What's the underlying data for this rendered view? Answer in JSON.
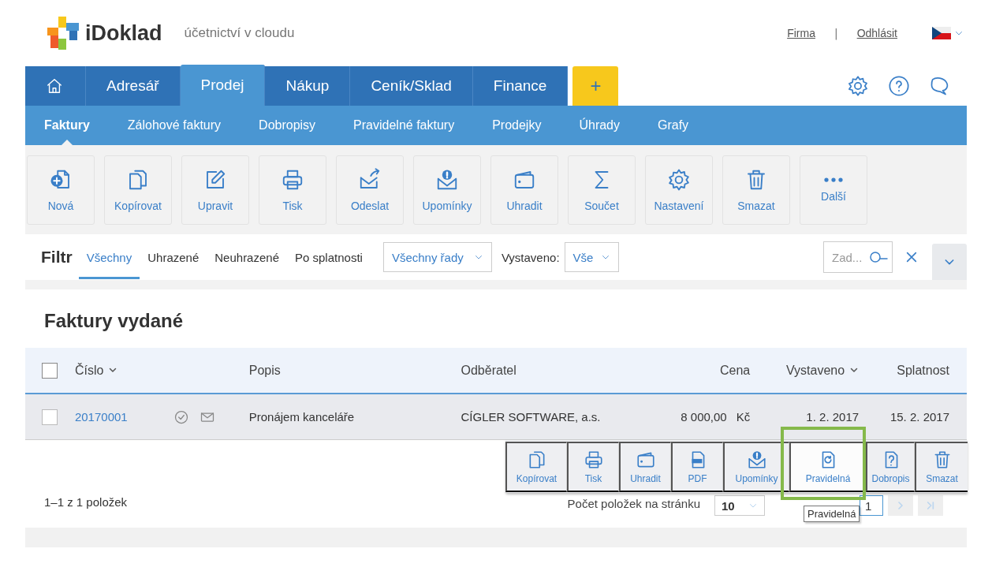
{
  "header": {
    "logo_text": "iDoklad",
    "tagline": "účetnictví v cloudu",
    "links": [
      "Firma",
      "Odhlásit"
    ],
    "separator": "|"
  },
  "main_tabs": [
    {
      "kind": "home",
      "selected": false
    },
    {
      "kind": "text",
      "label": "Adresář",
      "selected": false
    },
    {
      "kind": "text",
      "label": "Prodej",
      "selected": true
    },
    {
      "kind": "text",
      "label": "Nákup",
      "selected": false
    },
    {
      "kind": "text",
      "label": "Ceník/Sklad",
      "selected": false
    },
    {
      "kind": "text",
      "label": "Finance",
      "selected": false
    },
    {
      "kind": "add",
      "label": "+",
      "selected": false
    }
  ],
  "sub_tabs": [
    {
      "label": "Faktury",
      "selected": true
    },
    {
      "label": "Zálohové faktury",
      "selected": false
    },
    {
      "label": "Dobropisy",
      "selected": false
    },
    {
      "label": "Pravidelné faktury",
      "selected": false
    },
    {
      "label": "Prodejky",
      "selected": false
    },
    {
      "label": "Úhrady",
      "selected": false
    },
    {
      "label": "Grafy",
      "selected": false
    }
  ],
  "toolbar": [
    {
      "kind": "new",
      "label": "Nová"
    },
    {
      "kind": "copy",
      "label": "Kopírovat"
    },
    {
      "kind": "edit",
      "label": "Upravit"
    },
    {
      "kind": "print",
      "label": "Tisk"
    },
    {
      "kind": "send",
      "label": "Odeslat"
    },
    {
      "kind": "reminder",
      "label": "Upomínky"
    },
    {
      "kind": "pay",
      "label": "Uhradit"
    },
    {
      "kind": "sum",
      "label": "Součet"
    },
    {
      "kind": "settings",
      "label": "Nastavení"
    },
    {
      "kind": "delete",
      "label": "Smazat"
    },
    {
      "kind": "more",
      "label": "Další"
    }
  ],
  "filter": {
    "title": "Filtr",
    "tabs": [
      {
        "label": "Všechny",
        "selected": true
      },
      {
        "label": "Uhrazené",
        "selected": false
      },
      {
        "label": "Neuhrazené",
        "selected": false
      },
      {
        "label": "Po splatnosti",
        "selected": false
      }
    ],
    "series_select": "Všechny řady",
    "issued_label": "Vystaveno:",
    "issued_select": "Vše",
    "search": {
      "placeholder": "Zad..."
    }
  },
  "section_title": "Faktury vydané",
  "table": {
    "all_checked": false,
    "columns": [
      {
        "label": "Číslo",
        "sortable": true
      },
      {
        "label": "Popis",
        "sortable": false
      },
      {
        "label": "Odběratel",
        "sortable": false
      },
      {
        "label": "Cena",
        "sortable": false
      },
      {
        "label": "Vystaveno",
        "sortable": true
      },
      {
        "label": "Splatnost",
        "sortable": false
      }
    ],
    "rows": [
      {
        "checked": false,
        "number": "20170001",
        "paid": true,
        "sent": true,
        "description": "Pronájem kanceláře",
        "customer": "CÍGLER SOFTWARE, a.s.",
        "amount": "8 000,00",
        "currency": "Kč",
        "issued": "1. 2. 2017",
        "due": "15. 2. 2017"
      }
    ]
  },
  "pagination": {
    "summary": "1–1 z 1 položek",
    "per_page_label": "Počet položek na stránku",
    "per_page": "10",
    "page": "1"
  },
  "row_actions": [
    {
      "kind": "copy",
      "label": "Kopírovat",
      "selected": false
    },
    {
      "kind": "print",
      "label": "Tisk",
      "selected": false
    },
    {
      "kind": "pay",
      "label": "Uhradit",
      "selected": false
    },
    {
      "kind": "pdf",
      "label": "PDF",
      "selected": false
    },
    {
      "kind": "reminder",
      "label": "Upomínky",
      "selected": false
    },
    {
      "kind": "recurring",
      "label": "Pravidelná",
      "selected": true
    },
    {
      "kind": "creditnote",
      "label": "Dobropis",
      "selected": false
    },
    {
      "kind": "delete",
      "label": "Smazat",
      "selected": false
    }
  ],
  "tooltip": "Pravidelná"
}
